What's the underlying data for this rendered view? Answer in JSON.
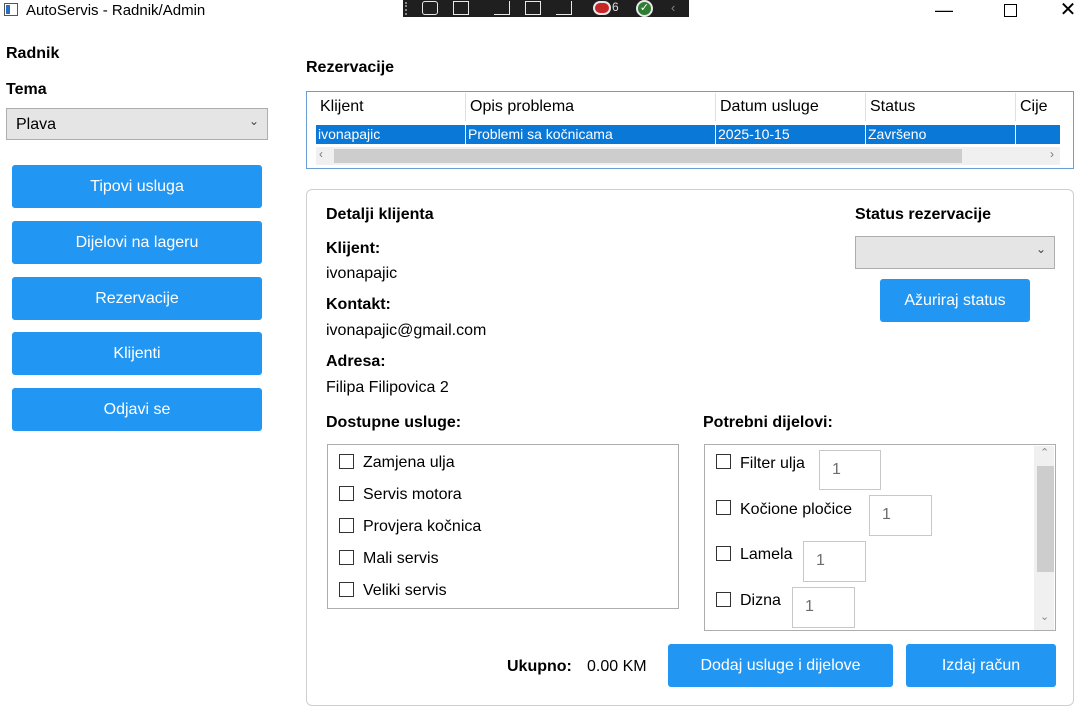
{
  "window": {
    "title": "AutoServis - Radnik/Admin",
    "devtools_count": "6"
  },
  "sidebar": {
    "heading": "Radnik",
    "theme_label": "Tema",
    "theme_value": "Plava",
    "nav": [
      {
        "label": "Tipovi usluga"
      },
      {
        "label": "Dijelovi na lageru"
      },
      {
        "label": "Rezervacije"
      },
      {
        "label": "Klijenti"
      },
      {
        "label": "Odjavi se"
      }
    ]
  },
  "reservations": {
    "title": "Rezervacije",
    "columns": [
      "Klijent",
      "Opis problema",
      "Datum usluge",
      "Status",
      "Cije"
    ],
    "rows": [
      {
        "klijent": "ivonapajic",
        "opis": "Problemi sa kočnicama",
        "datum": "2025-10-15",
        "status": "Završeno",
        "cijena": ""
      }
    ]
  },
  "details": {
    "heading": "Detalji klijenta",
    "client_label": "Klijent:",
    "client_value": "ivonapajic",
    "contact_label": "Kontakt:",
    "contact_value": "ivonapajic@gmail.com",
    "address_label": "Adresa:",
    "address_value": "Filipa Filipovica 2",
    "status_heading": "Status rezervacije",
    "status_value": "",
    "update_button": "Ažuriraj status"
  },
  "services": {
    "label": "Dostupne usluge:",
    "items": [
      "Zamjena ulja",
      "Servis motora",
      "Provjera kočnica",
      "Mali servis",
      "Veliki servis"
    ]
  },
  "parts": {
    "label": "Potrebni dijelovi:",
    "items": [
      {
        "name": "Filter ulja",
        "qty": "1"
      },
      {
        "name": "Kočione pločice",
        "qty": "1"
      },
      {
        "name": "Lamela",
        "qty": "1"
      },
      {
        "name": "Dizna",
        "qty": "1"
      }
    ]
  },
  "footer": {
    "total_label": "Ukupno:",
    "total_value": "0.00 KM",
    "add_button": "Dodaj usluge i dijelove",
    "invoice_button": "Izdaj račun"
  },
  "colors": {
    "accent": "#2196f3",
    "selection": "#0a78d7"
  }
}
